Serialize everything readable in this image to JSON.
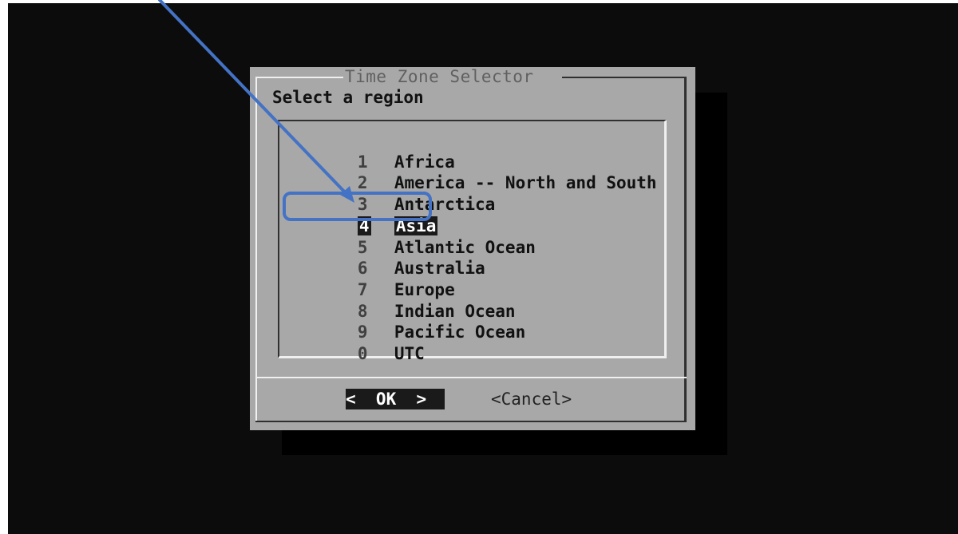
{
  "dialog": {
    "title": "Time Zone Selector",
    "prompt": "Select a region"
  },
  "regions": [
    {
      "num": "1",
      "label": "Africa"
    },
    {
      "num": "2",
      "label": "America -- North and South"
    },
    {
      "num": "3",
      "label": "Antarctica"
    },
    {
      "num": "4",
      "label": "Asia",
      "selected": true
    },
    {
      "num": "5",
      "label": "Atlantic Ocean"
    },
    {
      "num": "6",
      "label": "Australia"
    },
    {
      "num": "7",
      "label": "Europe"
    },
    {
      "num": "8",
      "label": "Indian Ocean"
    },
    {
      "num": "9",
      "label": "Pacific Ocean"
    },
    {
      "num": "0",
      "label": "UTC"
    }
  ],
  "buttons": {
    "ok_label": "<  OK  >",
    "cancel_label": "<Cancel>"
  },
  "annotation": {
    "color": "#4472c4",
    "type": "arrow-and-highlight-box"
  }
}
